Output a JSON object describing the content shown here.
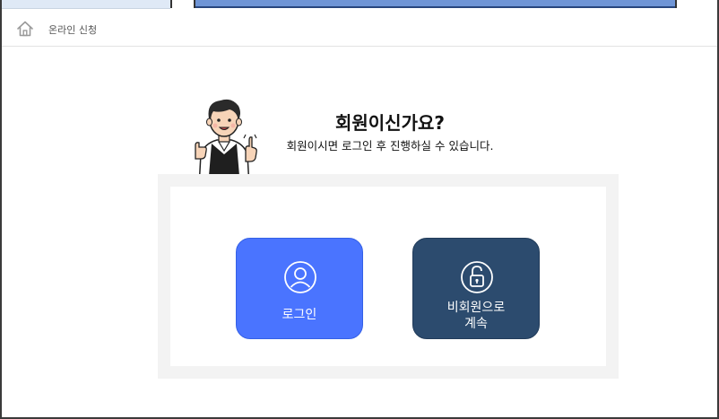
{
  "breadcrumb": {
    "home_icon": "home-icon",
    "label": "온라인 신청"
  },
  "header": {
    "title": "회원이신가요?",
    "subtitle": "회원이시면 로그인 후 진행하실 수 있습니다."
  },
  "options": {
    "login": {
      "label": "로그인",
      "icon": "user-circle-icon",
      "color": "#4a74ff"
    },
    "guest": {
      "label_line1": "비회원으로",
      "label_line2": "계속",
      "icon": "unlock-icon",
      "color": "#2c4b6e"
    }
  }
}
